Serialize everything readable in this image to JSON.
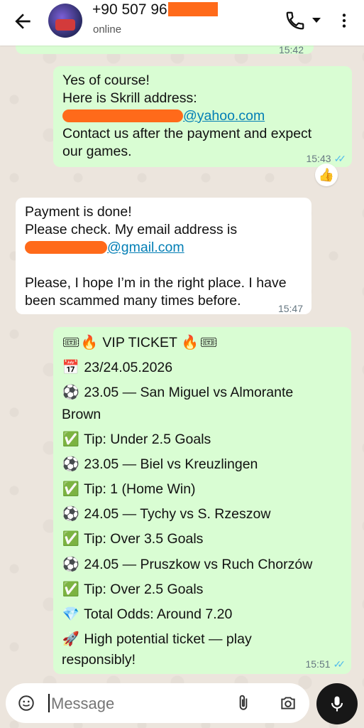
{
  "header": {
    "contact_name": "+90 507 96",
    "status": "online"
  },
  "messages": {
    "prev_time": "15:42",
    "m1": {
      "line1": "Yes of course!",
      "line2": "Here is Skrill address:",
      "email_domain": "@yahoo.com",
      "line4": "Contact us after the payment and expect",
      "line5": "our games.",
      "time": "15:43",
      "reaction": "👍"
    },
    "m2": {
      "line1": "Payment is done!",
      "line2": "Please check. My email address is",
      "email_domain": "@gmail.com",
      "line4": "Please, I hope I’m in the right place. I have",
      "line5": "been scammed many times before.",
      "time": "15:47"
    },
    "m3": {
      "title": "VIP TICKET",
      "date": "23/24.05.2026",
      "lines": [
        {
          "icon": "⚽",
          "text": "23.05 — San Miguel vs Almorante"
        },
        {
          "icon": "",
          "text": "Brown"
        },
        {
          "icon": "✅",
          "text": "Tip: Under 2.5 Goals"
        },
        {
          "icon": "⚽",
          "text": "23.05 — Biel vs Kreuzlingen"
        },
        {
          "icon": "✅",
          "text": "Tip: 1 (Home Win)"
        },
        {
          "icon": "⚽",
          "text": "24.05 — Tychy vs S. Rzeszow"
        },
        {
          "icon": "✅",
          "text": "Tip: Over 3.5 Goals"
        },
        {
          "icon": "⚽",
          "text": "24.05 — Pruszkow vs Ruch Chorzów"
        },
        {
          "icon": "✅",
          "text": "Tip: Over 2.5 Goals"
        },
        {
          "icon": "💎",
          "text": "Total Odds: Around 7.20"
        },
        {
          "icon": "🚀",
          "text": "High potential ticket — play"
        },
        {
          "icon": "",
          "text": "responsibly!"
        }
      ],
      "time": "15:51"
    }
  },
  "composer": {
    "placeholder": "Message"
  },
  "colors": {
    "outgoing_bubble": "#d9fdd3",
    "incoming_bubble": "#ffffff",
    "read_ticks": "#53bdeb",
    "link": "#027eb5",
    "redaction": "#ff6a1a"
  }
}
